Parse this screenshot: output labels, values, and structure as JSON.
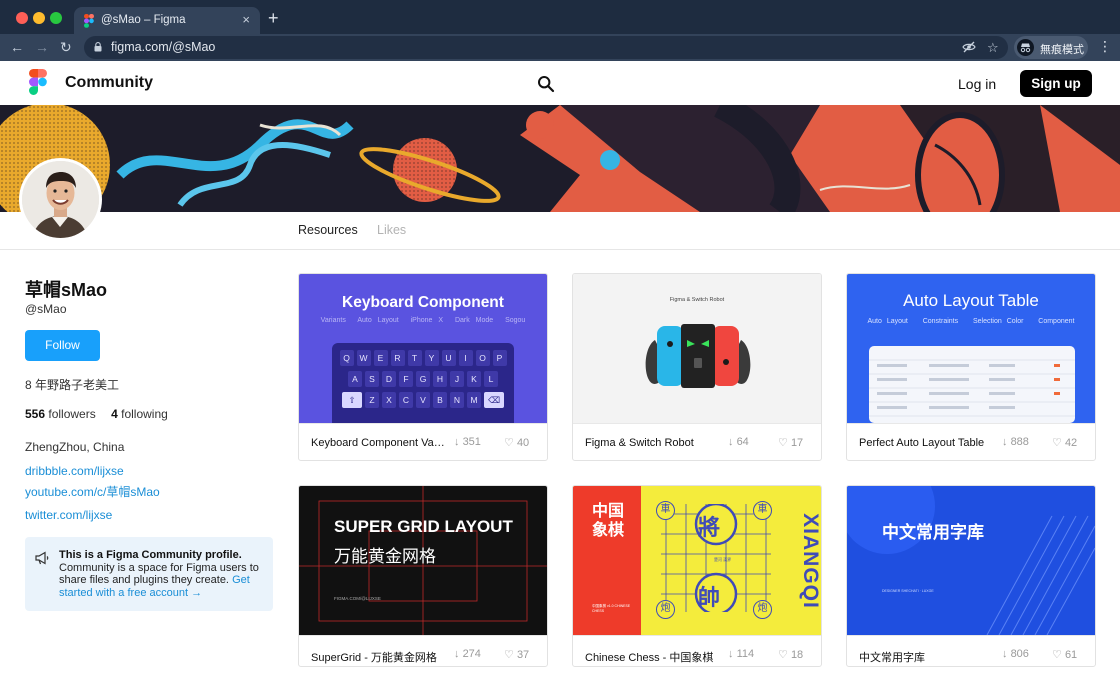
{
  "browser": {
    "tab_title": "@sMao – Figma",
    "tab_close": "×",
    "new_tab": "+",
    "url": "figma.com/@sMao",
    "incognito_label": "無痕模式",
    "back": "←",
    "forward": "→",
    "reload": "↻",
    "menu": "⋮"
  },
  "header": {
    "brand": "Community",
    "login": "Log in",
    "signup": "Sign up"
  },
  "profile_tabs": {
    "resources": "Resources",
    "likes": "Likes"
  },
  "profile": {
    "name": "草帽sMao",
    "handle": "@sMao",
    "follow_label": "Follow",
    "bio": "8 年野路子老美工",
    "followers_count": "556",
    "followers_label": "followers",
    "following_count": "4",
    "following_label": "following",
    "location": "ZhengZhou, China",
    "links": [
      "dribbble.com/lijxse",
      "youtube.com/c/草帽sMao",
      "twitter.com/lijxse"
    ]
  },
  "notice": {
    "title": "This is a Figma Community profile.",
    "body": "Community is a space for Figma users to share files and plugins they create.",
    "link": "Get started with a free account →"
  },
  "cards": [
    {
      "name": "Keyboard Component Vari...",
      "downloads": "351",
      "likes": "40",
      "thumb_title": "Keyboard Component",
      "thumb_tags": [
        "Variants",
        "Auto Layout",
        "iPhone X",
        "Dark Mode",
        "Sogou"
      ],
      "keys_row1": [
        "Q",
        "W",
        "E",
        "R",
        "T",
        "Y",
        "U",
        "I",
        "O",
        "P"
      ],
      "keys_row2": [
        "A",
        "S",
        "D",
        "F",
        "G",
        "H",
        "J",
        "K",
        "L"
      ],
      "keys_row3": [
        "Z",
        "X",
        "C",
        "V",
        "B",
        "N",
        "M"
      ]
    },
    {
      "name": "Figma & Switch Robot",
      "downloads": "64",
      "likes": "17",
      "thumb_title": "Figma & Switch Robot"
    },
    {
      "name": "Perfect Auto Layout Table",
      "downloads": "888",
      "likes": "42",
      "thumb_title": "Auto Layout Table",
      "thumb_tags": [
        "Auto Layout",
        "Constraints",
        "Selection Color",
        "Component"
      ]
    },
    {
      "name": "SuperGrid - 万能黄金网格",
      "downloads": "274",
      "likes": "37",
      "thumb_title": "SUPER GRID LAYOUT",
      "thumb_sub": "万能黄金网格",
      "thumb_small": "FIGMA.COM/@LIJXSE"
    },
    {
      "name": "Chinese Chess - 中国象棋",
      "downloads": "114",
      "likes": "18",
      "thumb_title": "中国\n象棋",
      "thumb_side": "XIANGQI",
      "thumb_small": "中国象棋 v1.0 CHINESE CHESS",
      "piece_top": "將",
      "piece_bottom": "帥",
      "corner_tl": "車",
      "corner_tr": "車",
      "corner_bl": "炮",
      "corner_br": "炮",
      "river": "楚河 漢界"
    },
    {
      "name": "中文常用字库",
      "downloads": "806",
      "likes": "61",
      "thumb_title": "中文常用字库",
      "thumb_small": "DESIGNER SHECHATI · LUXGE"
    }
  ],
  "icons": {
    "download": "↓",
    "like": "♡"
  },
  "colors": {
    "accent": "#18a0fb",
    "signup_bg": "#000000",
    "chrome_dark": "#1e2c40",
    "chrome_bar": "#33435a"
  }
}
